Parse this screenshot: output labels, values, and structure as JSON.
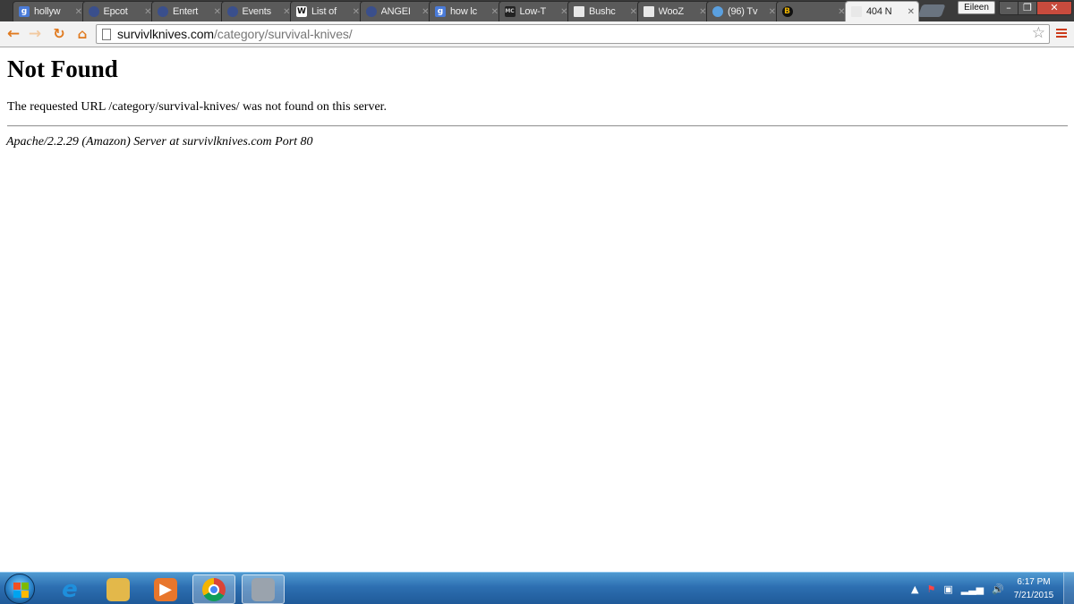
{
  "browser": {
    "tabs": [
      {
        "title": "hollyw",
        "icon": "google-icon",
        "fav": "g",
        "fav_class": "fav-g"
      },
      {
        "title": "Epcot",
        "icon": "shield-icon",
        "fav": "",
        "fav_class": "fav-shield"
      },
      {
        "title": "Entert",
        "icon": "shield-icon",
        "fav": "",
        "fav_class": "fav-shield"
      },
      {
        "title": "Events",
        "icon": "shield-icon",
        "fav": "",
        "fav_class": "fav-shield"
      },
      {
        "title": "List of",
        "icon": "wikipedia-icon",
        "fav": "W",
        "fav_class": "fav-w"
      },
      {
        "title": "ANGEI",
        "icon": "emblem-icon",
        "fav": "",
        "fav_class": "fav-shield"
      },
      {
        "title": "how lc",
        "icon": "google-icon",
        "fav": "g",
        "fav_class": "fav-g"
      },
      {
        "title": "Low-T",
        "icon": "mc-icon",
        "fav": "MC",
        "fav_class": "fav-mc"
      },
      {
        "title": "Bushc",
        "icon": "document-icon",
        "fav": "",
        "fav_class": "fav-doc"
      },
      {
        "title": "WooZ",
        "icon": "document-icon",
        "fav": "",
        "fav_class": "fav-doc"
      },
      {
        "title": "(96) Tv",
        "icon": "bird-icon",
        "fav": "",
        "fav_class": "fav-bird"
      },
      {
        "title": "",
        "icon": "bruins-icon",
        "fav": "B",
        "fav_class": "fav-bag"
      },
      {
        "title": "404 N",
        "icon": "document-icon",
        "fav": "",
        "fav_class": "fav-doc",
        "active": true
      }
    ],
    "user_name": "Eileen",
    "url_host": "survivlknives.com",
    "url_path": "/category/survival-knives/"
  },
  "page": {
    "title": "Not Found",
    "message": "The requested URL /category/survival-knives/ was not found on this server.",
    "address": "Apache/2.2.29 (Amazon) Server at survivlknives.com Port 80"
  },
  "taskbar": {
    "apps": [
      {
        "name": "internet-explorer",
        "glyph": "e",
        "color": "#1e8fdc",
        "bg": "#ffffff00"
      },
      {
        "name": "file-explorer",
        "glyph": "",
        "color": "#e3b84a",
        "bg": "#e3b84a"
      },
      {
        "name": "media-player",
        "glyph": "▶",
        "color": "#ffffff",
        "bg": "#e8762c"
      },
      {
        "name": "chrome",
        "glyph": "",
        "color": "#ffffff",
        "bg": "#ffffff00",
        "active": true
      },
      {
        "name": "file-cabinet",
        "glyph": "",
        "color": "#cfcfcf",
        "bg": "#9aa3ad",
        "active": true
      }
    ],
    "time": "6:17 PM",
    "date": "7/21/2015"
  }
}
